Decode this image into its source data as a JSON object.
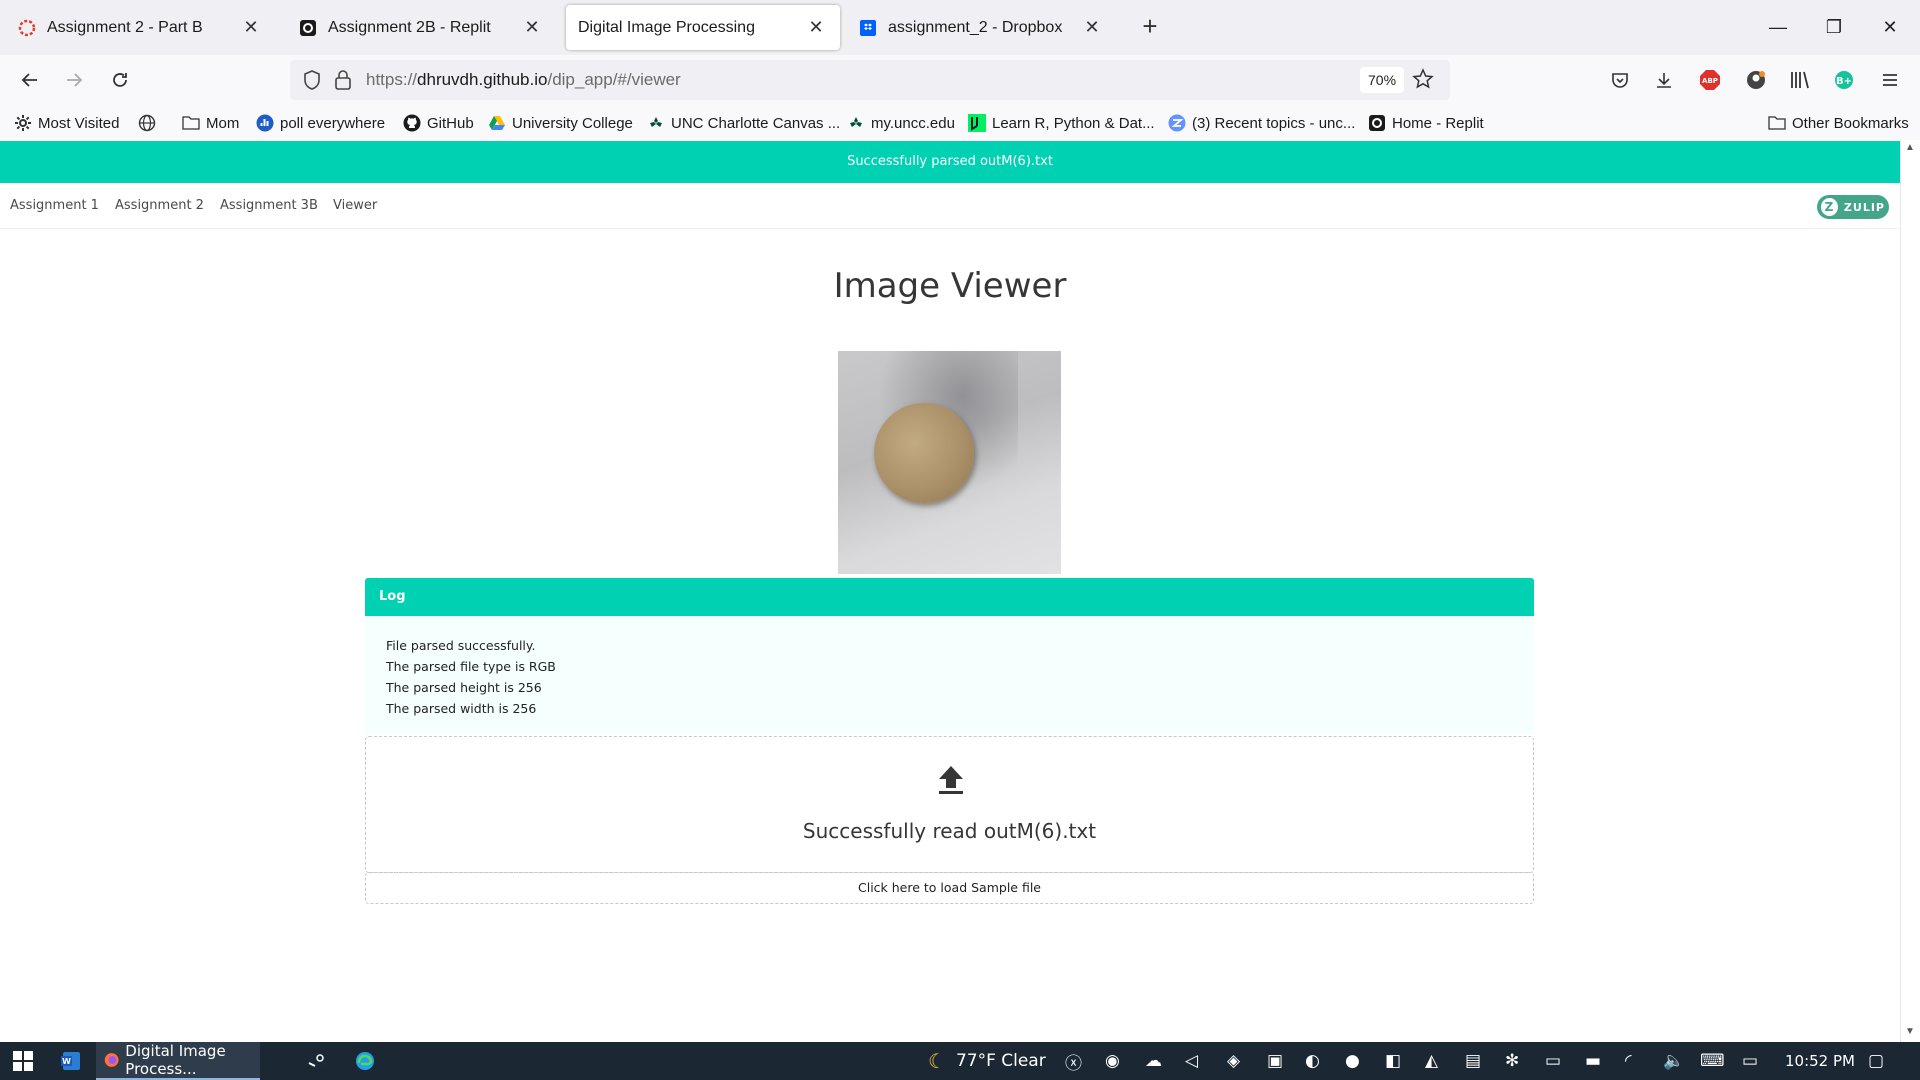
{
  "browser": {
    "tabs": [
      {
        "title": "Assignment 2 - Part B",
        "icon": "canvas-icon",
        "active": false
      },
      {
        "title": "Assignment 2B - Replit",
        "icon": "replit-icon",
        "active": false
      },
      {
        "title": "Digital Image Processing",
        "icon": "none",
        "active": true
      },
      {
        "title": "assignment_2 - Dropbox",
        "icon": "dropbox-icon",
        "active": false
      }
    ],
    "url_prefix": "https://",
    "url_host": "dhruvdh.github.io",
    "url_path": "/dip_app/#/viewer",
    "zoom": "70%",
    "bookmarks": [
      {
        "label": "Most Visited",
        "icon": "gear-icon"
      },
      {
        "label": "",
        "icon": "globe-icon"
      },
      {
        "label": "Mom",
        "icon": "folder-icon"
      },
      {
        "label": "poll everywhere",
        "icon": "polleverywhere-icon"
      },
      {
        "label": "GitHub",
        "icon": "github-icon"
      },
      {
        "label": "University College",
        "icon": "google-drive-icon"
      },
      {
        "label": "UNC Charlotte Canvas ...",
        "icon": "uncc-icon"
      },
      {
        "label": "my.uncc.edu",
        "icon": "uncc-icon"
      },
      {
        "label": "Learn R, Python & Dat...",
        "icon": "datacamp-icon"
      },
      {
        "label": "(3) Recent topics - unc...",
        "icon": "zulip-icon"
      },
      {
        "label": "Home - Replit",
        "icon": "replit-icon"
      }
    ],
    "other_bookmarks": "Other Bookmarks"
  },
  "app": {
    "notification": "Successfully parsed outM(6).txt",
    "nav": [
      "Assignment 1",
      "Assignment 2",
      "Assignment 3B",
      "Viewer"
    ],
    "zulip_badge": "ZULIP",
    "page_title": "Image Viewer",
    "log": {
      "header": "Log",
      "lines": [
        "File parsed successfully.",
        "The parsed file type is RGB",
        "The parsed height is 256",
        "The parsed width is 256"
      ]
    },
    "upload_message": "Successfully read outM(6).txt",
    "sample_link": "Click here to load Sample file"
  },
  "taskbar": {
    "active_app": "Digital Image Process...",
    "weather": "77°F  Clear",
    "time": "10:52 PM"
  },
  "colors": {
    "accent": "#00d1b2",
    "log_bg": "#f5fffd",
    "taskbar": "#1c2734"
  }
}
